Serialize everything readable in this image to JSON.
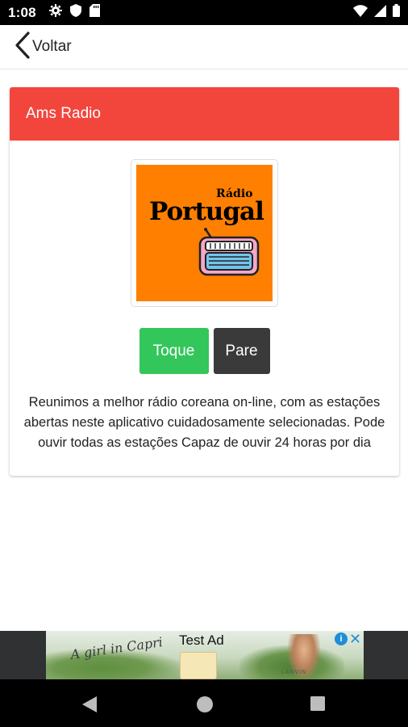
{
  "status_bar": {
    "time": "1:08"
  },
  "app_bar": {
    "back_label": "Voltar"
  },
  "card": {
    "title": "Ams Radio",
    "logo": {
      "small_text": "Rádio",
      "big_text": "Portugal"
    },
    "play_label": "Toque",
    "stop_label": "Pare",
    "description": "Reunimos a melhor rádio coreana on-line, com as estações abertas neste aplicativo cuidadosamente selecionadas. Pode ouvir todas as estações Capaz de ouvir 24 horas por dia"
  },
  "ad": {
    "label": "Test Ad",
    "script_text": "A girl in Capri",
    "brand_text": "LANVIN"
  },
  "colors": {
    "header": "#f2463d",
    "play_button": "#33c65a",
    "stop_button": "#3a3a3a",
    "logo_background": "#ff7f00"
  },
  "icons": {
    "status": [
      "settings-icon",
      "shield-icon",
      "sd-card-icon",
      "wifi-icon",
      "signal-icon",
      "battery-icon"
    ],
    "nav": [
      "back-triangle-icon",
      "home-circle-icon",
      "recents-square-icon"
    ]
  }
}
